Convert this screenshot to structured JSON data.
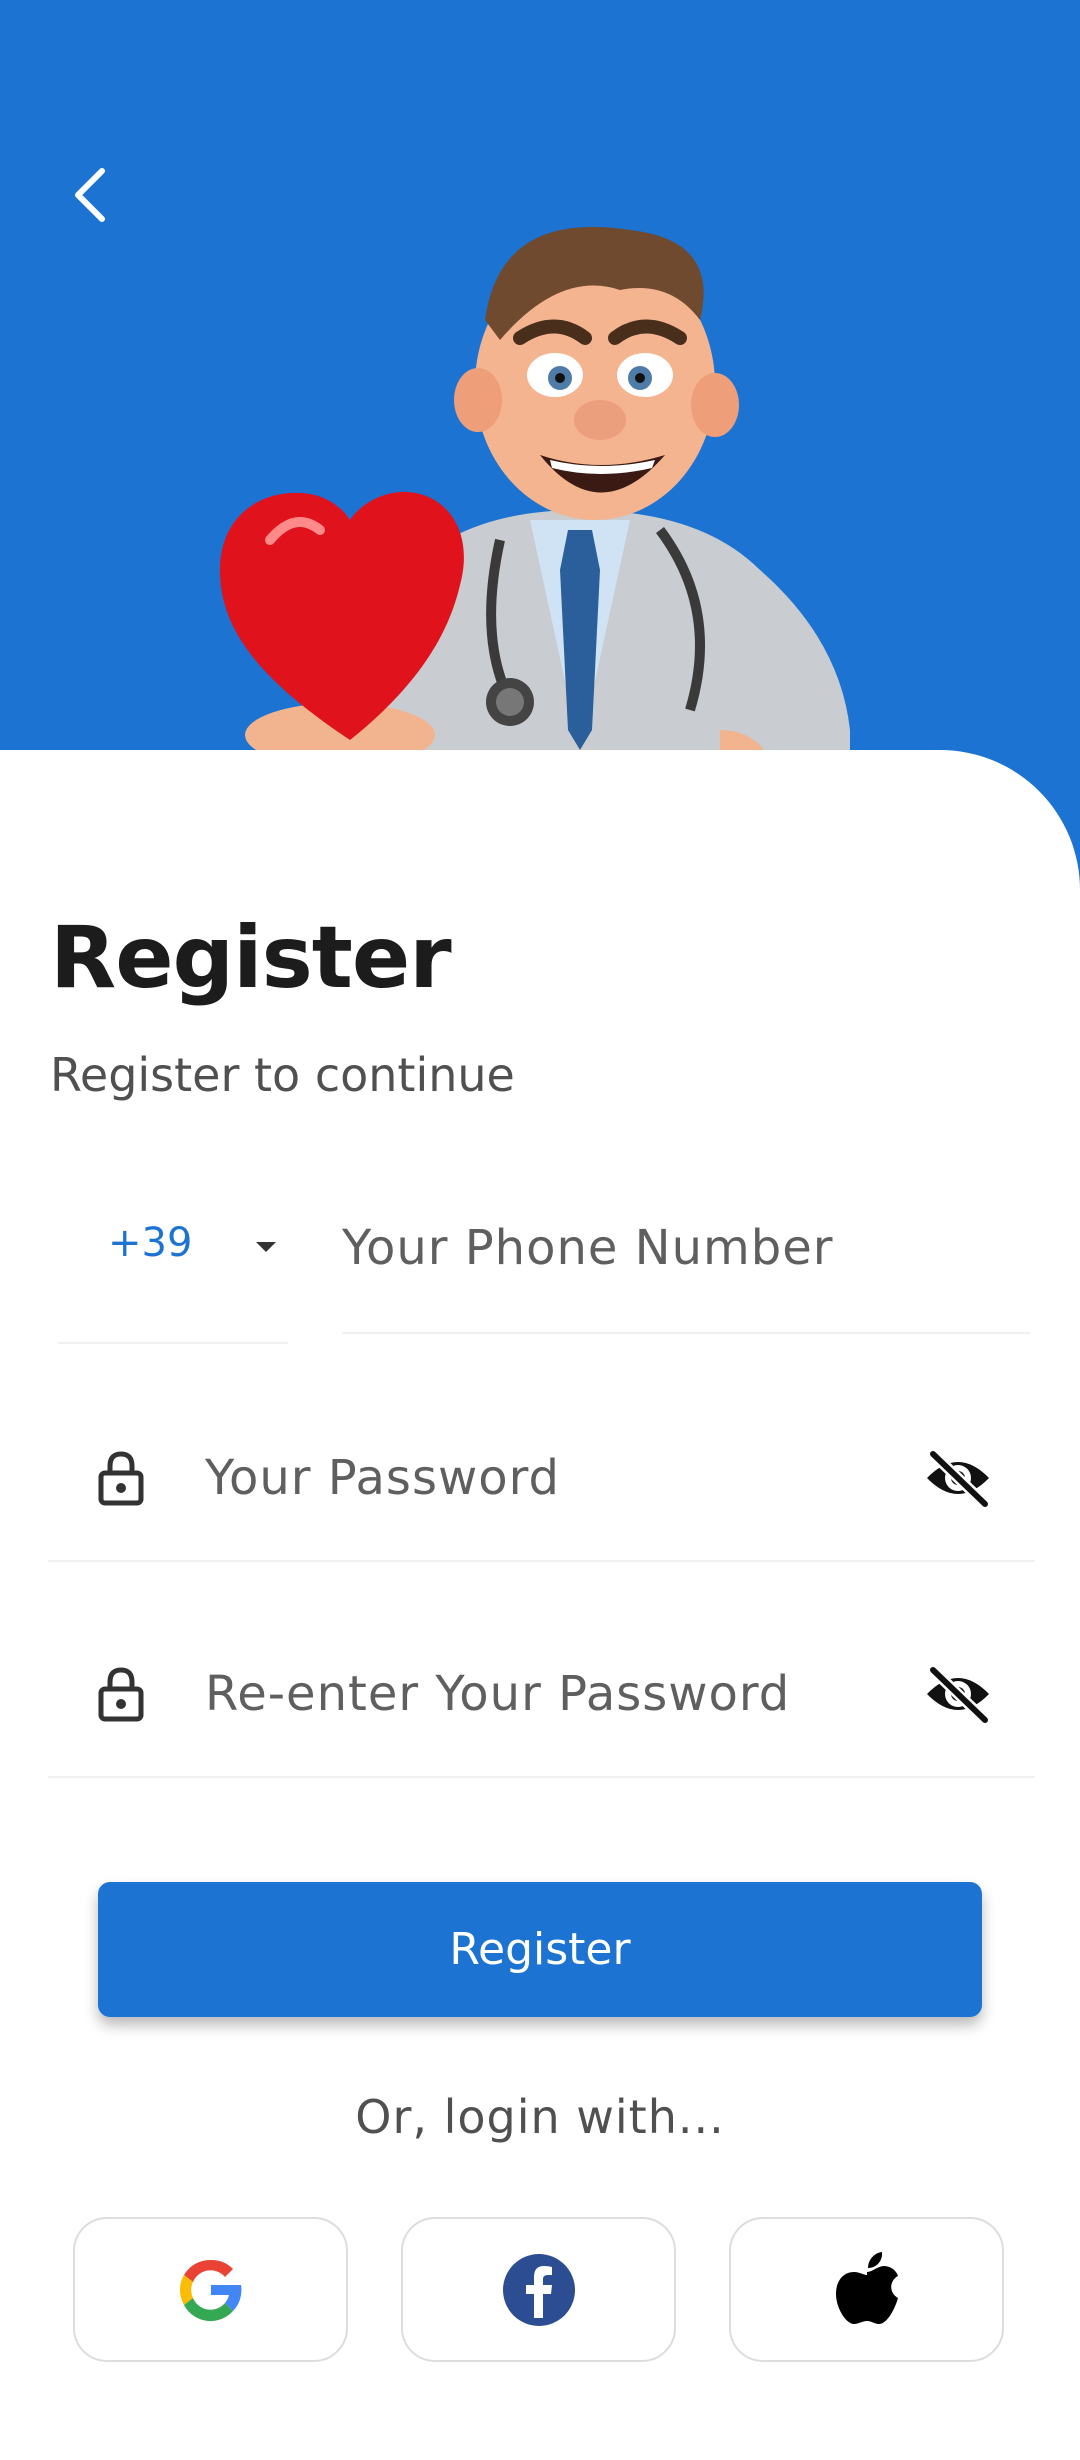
{
  "header": {
    "back_icon": "chevron-left-icon",
    "illustration": "doctor-holding-heart-illustration"
  },
  "title": "Register",
  "subtitle": "Register to continue",
  "phone": {
    "country_code": "+39",
    "placeholder": "Your Phone Number"
  },
  "password": {
    "placeholder": "Your Password",
    "lock_icon": "lock-icon",
    "toggle_icon": "eye-off-icon"
  },
  "confirm_password": {
    "placeholder": "Re-enter Your Password",
    "lock_icon": "lock-icon",
    "toggle_icon": "eye-off-icon"
  },
  "register_button": "Register",
  "social_login": {
    "label": "Or, login with...",
    "providers": [
      {
        "name": "google",
        "icon": "google-icon"
      },
      {
        "name": "facebook",
        "icon": "facebook-icon"
      },
      {
        "name": "apple",
        "icon": "apple-icon"
      }
    ]
  },
  "colors": {
    "primary": "#1c73d2",
    "background": "#ffffff",
    "text_dark": "#1c1c1c",
    "text_muted": "#5f5f5f"
  }
}
